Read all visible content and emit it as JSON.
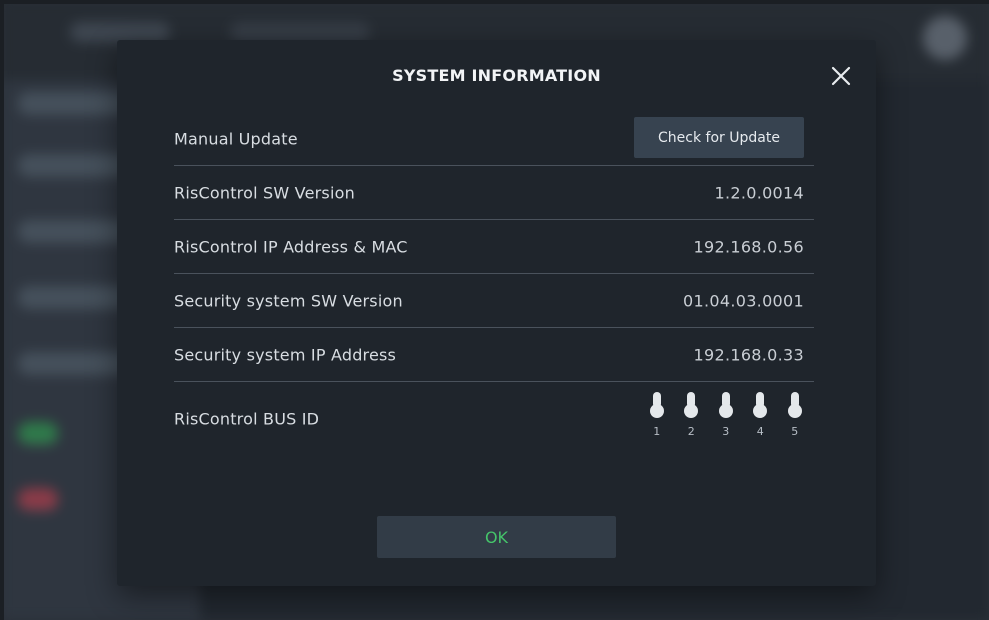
{
  "dialog": {
    "title": "SYSTEM INFORMATION",
    "close_icon": "close-icon",
    "ok_label": "OK",
    "ok_color": "#45c46a"
  },
  "rows": [
    {
      "label": "Manual Update",
      "button_label": "Check for Update"
    },
    {
      "label": "RisControl SW Version",
      "value": "1.2.0.0014"
    },
    {
      "label": "RisControl IP Address & MAC",
      "value": "192.168.0.56"
    },
    {
      "label": "Security system SW Version",
      "value": "01.04.03.0001"
    },
    {
      "label": "Security system IP Address",
      "value": "192.168.0.33"
    },
    {
      "label": "RisControl BUS ID"
    }
  ],
  "bus_id_switches": [
    {
      "number": "1",
      "icon": "dip-switch-icon"
    },
    {
      "number": "2",
      "icon": "dip-switch-icon"
    },
    {
      "number": "3",
      "icon": "dip-switch-icon"
    },
    {
      "number": "4",
      "icon": "dip-switch-icon"
    },
    {
      "number": "5",
      "icon": "dip-switch-icon"
    }
  ]
}
